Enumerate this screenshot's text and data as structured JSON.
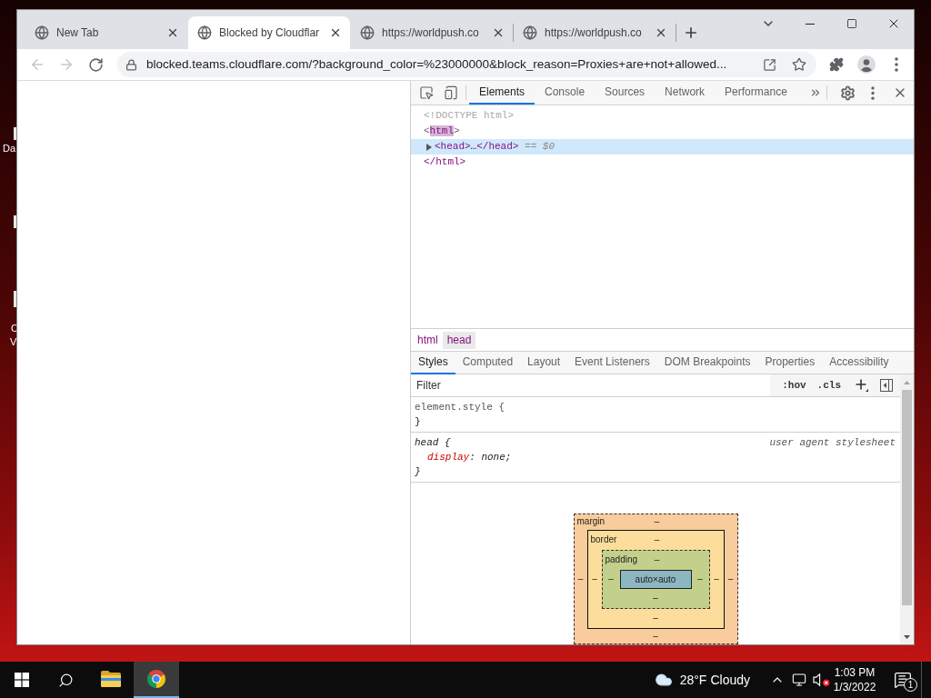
{
  "desktop": {
    "icon_labels": [
      "Da",
      "C",
      "V"
    ]
  },
  "browser": {
    "tabs": [
      {
        "title": "New Tab",
        "selected": false
      },
      {
        "title": "Blocked by Cloudflar",
        "selected": true
      },
      {
        "title": "https://worldpush.co",
        "selected": false
      },
      {
        "title": "https://worldpush.co",
        "selected": false
      }
    ],
    "back_disabled": true,
    "forward_disabled": true,
    "url": "blocked.teams.cloudflare.com/?background_color=%23000000&block_reason=Proxies+are+not+allowed..."
  },
  "devtools": {
    "panel_tabs": [
      {
        "label": "Elements",
        "selected": true
      },
      {
        "label": "Console",
        "selected": false
      },
      {
        "label": "Sources",
        "selected": false
      },
      {
        "label": "Network",
        "selected": false
      },
      {
        "label": "Performance",
        "selected": false
      }
    ],
    "dom_tree": [
      {
        "tokens": [
          {
            "kind": "dim",
            "text": "<!DOCTYPE html>"
          }
        ],
        "selected": false
      },
      {
        "tokens": [
          {
            "kind": "punct",
            "text": "<"
          },
          {
            "kind": "match",
            "text": "html"
          },
          {
            "kind": "punct",
            "text": ">"
          }
        ],
        "selected": false,
        "children": [
          {
            "tokens": [
              {
                "kind": "tag",
                "text": "<head>"
              },
              {
                "kind": "text",
                "text": "…"
              },
              {
                "kind": "tag",
                "text": "</head>"
              },
              {
                "kind": "ref",
                "text": "=="
              },
              {
                "kind": "var",
                "text": "$0"
              }
            ],
            "selected": true,
            "expanded": false
          }
        ],
        "close_tokens": [
          {
            "kind": "tag",
            "text": "</html>"
          }
        ]
      }
    ],
    "breadcrumbs": [
      {
        "label": "html",
        "selected": false
      },
      {
        "label": "head",
        "selected": true
      }
    ],
    "sidebar_tabs": [
      {
        "label": "Styles",
        "selected": true
      },
      {
        "label": "Computed",
        "selected": false
      },
      {
        "label": "Layout",
        "selected": false
      },
      {
        "label": "Event Listeners",
        "selected": false
      },
      {
        "label": "DOM Breakpoints",
        "selected": false
      },
      {
        "label": "Properties",
        "selected": false
      },
      {
        "label": "Accessibility",
        "selected": false
      }
    ],
    "filter": {
      "placeholder": "Filter",
      "buttons": [
        ":hov",
        ".cls"
      ]
    },
    "rules": [
      {
        "kind": "inline",
        "selector": "element.style {",
        "close": "}"
      },
      {
        "kind": "user_agent",
        "selector": "head {",
        "source": "user agent stylesheet",
        "declarations": [
          {
            "property": "display",
            "value": ": none;"
          }
        ],
        "close": "}"
      }
    ],
    "box_model": {
      "layers": [
        {
          "kind": "margin",
          "label": "margin",
          "top": "–"
        },
        {
          "kind": "border",
          "label": "border",
          "top": "–"
        },
        {
          "kind": "padding",
          "label": "padding",
          "top": "–"
        }
      ],
      "left": [
        "–",
        "–",
        "–"
      ],
      "content": "auto×auto",
      "right": [
        "–",
        "–",
        "–"
      ],
      "bottom": [
        "–",
        "–",
        "–"
      ]
    }
  },
  "taskbar": {
    "apps": [
      {
        "kind": "file_explorer",
        "active": false
      },
      {
        "kind": "browser",
        "active": true
      }
    ],
    "weather": {
      "temperature": "28°F",
      "condition": "Cloudy"
    },
    "volume_muted": true,
    "time": "1:03 PM",
    "date": "1/3/2022",
    "notifications": "1"
  }
}
